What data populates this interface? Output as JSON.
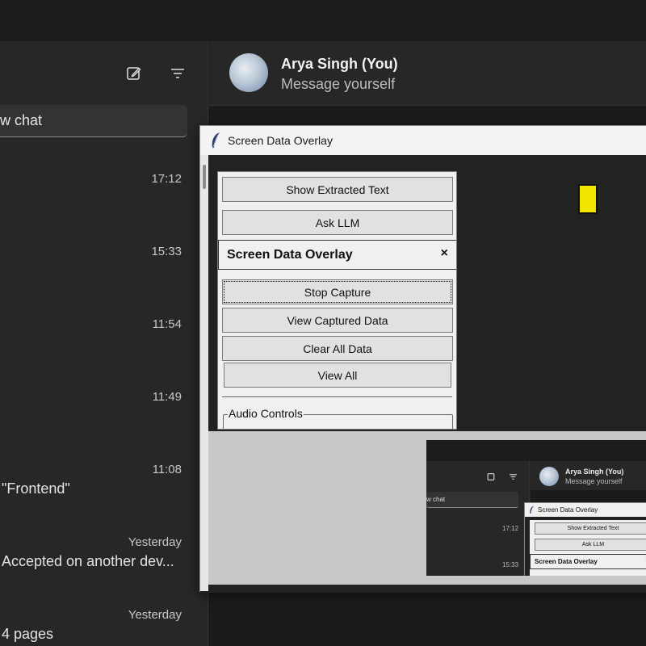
{
  "sidebar": {
    "search_text": "w chat",
    "chats": [
      {
        "time": "17:12",
        "preview": ""
      },
      {
        "time": "15:33",
        "preview": ""
      },
      {
        "time": "11:54",
        "preview": ""
      },
      {
        "time": "11:49",
        "preview": ""
      },
      {
        "time": "11:08",
        "preview": "\"Frontend\""
      },
      {
        "time": "Yesterday",
        "preview": "Accepted on another dev..."
      },
      {
        "time": "Yesterday",
        "preview": "4 pages"
      }
    ]
  },
  "conversation": {
    "contact_name": "Arya Singh (You)",
    "contact_subtitle": "Message yourself"
  },
  "overlay": {
    "window_title": "Screen Data Overlay",
    "buttons": {
      "show_extracted_text": "Show Extracted Text",
      "ask_llm": "Ask LLM",
      "stop_capture": "Stop Capture",
      "view_captured_data": "View Captured Data",
      "clear_all_data": "Clear All Data",
      "view_all": "View All"
    },
    "popup": {
      "title": "Screen Data Overlay",
      "close": "×"
    },
    "audio_controls_label": "Audio Controls",
    "marker_color": "#f2e600"
  },
  "thumbnail": {
    "contact_name": "Arya Singh (You)",
    "contact_subtitle": "Message yourself",
    "search_text": "w chat",
    "times": [
      "17:12",
      "15:33"
    ],
    "window_title": "Screen Data Overlay",
    "btn_show_extracted_text": "Show Extracted Text",
    "btn_ask_llm": "Ask LLM",
    "popup_title": "Screen Data Overlay",
    "popup_close": "×"
  },
  "icons": [
    "new-chat-icon",
    "filter-icon",
    "feather-icon",
    "close-icon"
  ]
}
